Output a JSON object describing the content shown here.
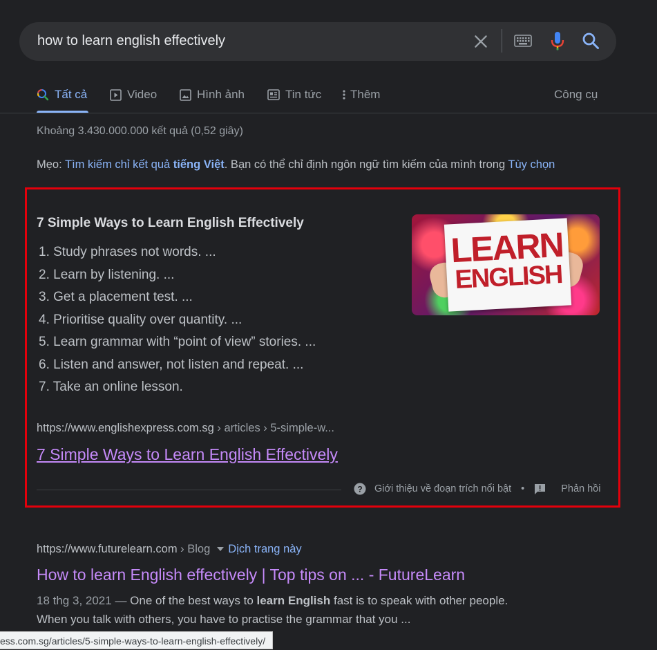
{
  "search": {
    "query": "how to learn english effectively"
  },
  "tabs": [
    {
      "label": "Tất cả"
    },
    {
      "label": "Video"
    },
    {
      "label": "Hình ảnh"
    },
    {
      "label": "Tin tức"
    },
    {
      "label": "Thêm"
    }
  ],
  "tools_label": "Công cụ",
  "stats": "Khoảng 3.430.000.000 kết quả (0,52 giây)",
  "tip": {
    "prefix": "Mẹo:",
    "link_part1": "Tìm kiếm chỉ kết quả",
    "link_bold": "tiếng Việt",
    "middle": ". Bạn có thể chỉ định ngôn ngữ tìm kiếm của mình trong",
    "options_link": "Tùy chọn"
  },
  "snippet": {
    "title": "7 Simple Ways to Learn English Effectively",
    "steps": [
      "1. Study phrases not words. ...",
      "2. Learn by listening. ...",
      "3. Get a placement test. ...",
      "4. Prioritise quality over quantity. ...",
      "5. Learn grammar with “point of view” stories. ...",
      "6. Listen and answer, not listen and repeat. ...",
      "7. Take an online lesson."
    ],
    "image_text_line1": "LEARN",
    "image_text_line2": "ENGLISH",
    "url": "https://www.englishexpress.com.sg",
    "breadcrumb": " › articles › 5-simple-w...",
    "link_title": "7 Simple Ways to Learn English Effectively",
    "about_label": "Giới thiệu về đoạn trích nổi bật",
    "separator": "•",
    "feedback_label": "Phản hồi"
  },
  "result2": {
    "url": "https://www.futurelearn.com",
    "breadcrumb": " › Blog",
    "translate_label": "Dịch trang này",
    "title": "How to learn English effectively | Top tips on ... - FutureLearn",
    "date": "18 thg 3, 2021",
    "dash": " — ",
    "snippet_a": "One of the best ways to ",
    "snippet_bold": "learn English",
    "snippet_b": " fast is to speak with other people.",
    "snippet_line2": "When you talk with others, you have to practise the grammar that you ..."
  },
  "status_bar": "ess.com.sg/articles/5-simple-ways-to-learn-english-effectively/",
  "colors": {
    "background": "#202124",
    "link_blue": "#8ab4f8",
    "visited_purple": "#c58af9",
    "highlight_frame": "#e3000b"
  }
}
